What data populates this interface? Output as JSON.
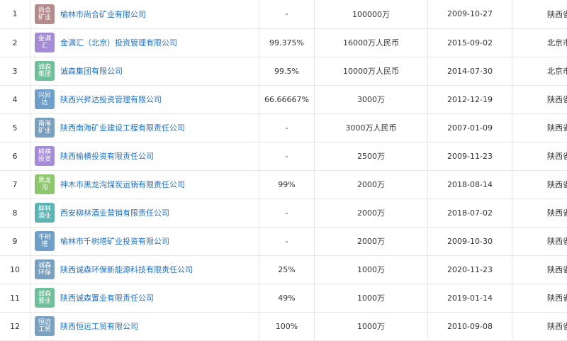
{
  "rows": [
    {
      "index": "1",
      "logo_text": "尚合矿业",
      "logo_color": "#b38b8b",
      "name": "榆林市尚合矿业有限公司",
      "ratio": "-",
      "capital": "100000万",
      "date": "2009-10-27",
      "province": "陕西省"
    },
    {
      "index": "2",
      "logo_text": "金满汇",
      "logo_color": "#a38bd6",
      "name": "金满汇（北京）投资管理有限公司",
      "ratio": "99.375%",
      "capital": "16000万人民币",
      "date": "2015-09-02",
      "province": "北京市"
    },
    {
      "index": "3",
      "logo_text": "诚森集团",
      "logo_color": "#6fbf9a",
      "name": "诚森集团有限公司",
      "ratio": "99.5%",
      "capital": "10000万人民币",
      "date": "2014-07-30",
      "province": "北京市"
    },
    {
      "index": "4",
      "logo_text": "兴昇达",
      "logo_color": "#6f9fc8",
      "name": "陕西兴昇达投资管理有限公司",
      "ratio": "66.66667%",
      "capital": "3000万",
      "date": "2012-12-19",
      "province": "陕西省"
    },
    {
      "index": "5",
      "logo_text": "南海矿业",
      "logo_color": "#7aa0bf",
      "name": "陕西南海矿业建设工程有限责任公司",
      "ratio": "-",
      "capital": "3000万人民币",
      "date": "2007-01-09",
      "province": "陕西省"
    },
    {
      "index": "6",
      "logo_text": "榆横投资",
      "logo_color": "#a38bd6",
      "name": "陕西榆横投资有限责任公司",
      "ratio": "-",
      "capital": "2500万",
      "date": "2009-11-23",
      "province": "陕西省"
    },
    {
      "index": "7",
      "logo_text": "黑龙沟",
      "logo_color": "#8fc56e",
      "name": "神木市黑龙沟煤炭运销有限责任公司",
      "ratio": "99%",
      "capital": "2000万",
      "date": "2018-08-14",
      "province": "陕西省"
    },
    {
      "index": "8",
      "logo_text": "柳林酒业",
      "logo_color": "#5fb3b3",
      "name": "西安柳林酒业营销有限责任公司",
      "ratio": "-",
      "capital": "2000万",
      "date": "2018-07-02",
      "province": "陕西省"
    },
    {
      "index": "9",
      "logo_text": "千树塔",
      "logo_color": "#6f9fc8",
      "name": "榆林市千树塔矿业投资有限公司",
      "ratio": "-",
      "capital": "2000万",
      "date": "2009-10-30",
      "province": "陕西省"
    },
    {
      "index": "10",
      "logo_text": "诚森环保",
      "logo_color": "#7aa0bf",
      "name": "陕西诚森环保新能源科技有限责任公司",
      "ratio": "25%",
      "capital": "1000万",
      "date": "2020-11-23",
      "province": "陕西省"
    },
    {
      "index": "11",
      "logo_text": "诚森置业",
      "logo_color": "#6fbf9a",
      "name": "陕西诚森置业有限责任公司",
      "ratio": "49%",
      "capital": "1000万",
      "date": "2019-01-14",
      "province": "陕西省"
    },
    {
      "index": "12",
      "logo_text": "恒远工贸",
      "logo_color": "#7aa0bf",
      "name": "陕西恒远工贸有限公司",
      "ratio": "100%",
      "capital": "1000万",
      "date": "2010-09-08",
      "province": "陕西省"
    }
  ]
}
